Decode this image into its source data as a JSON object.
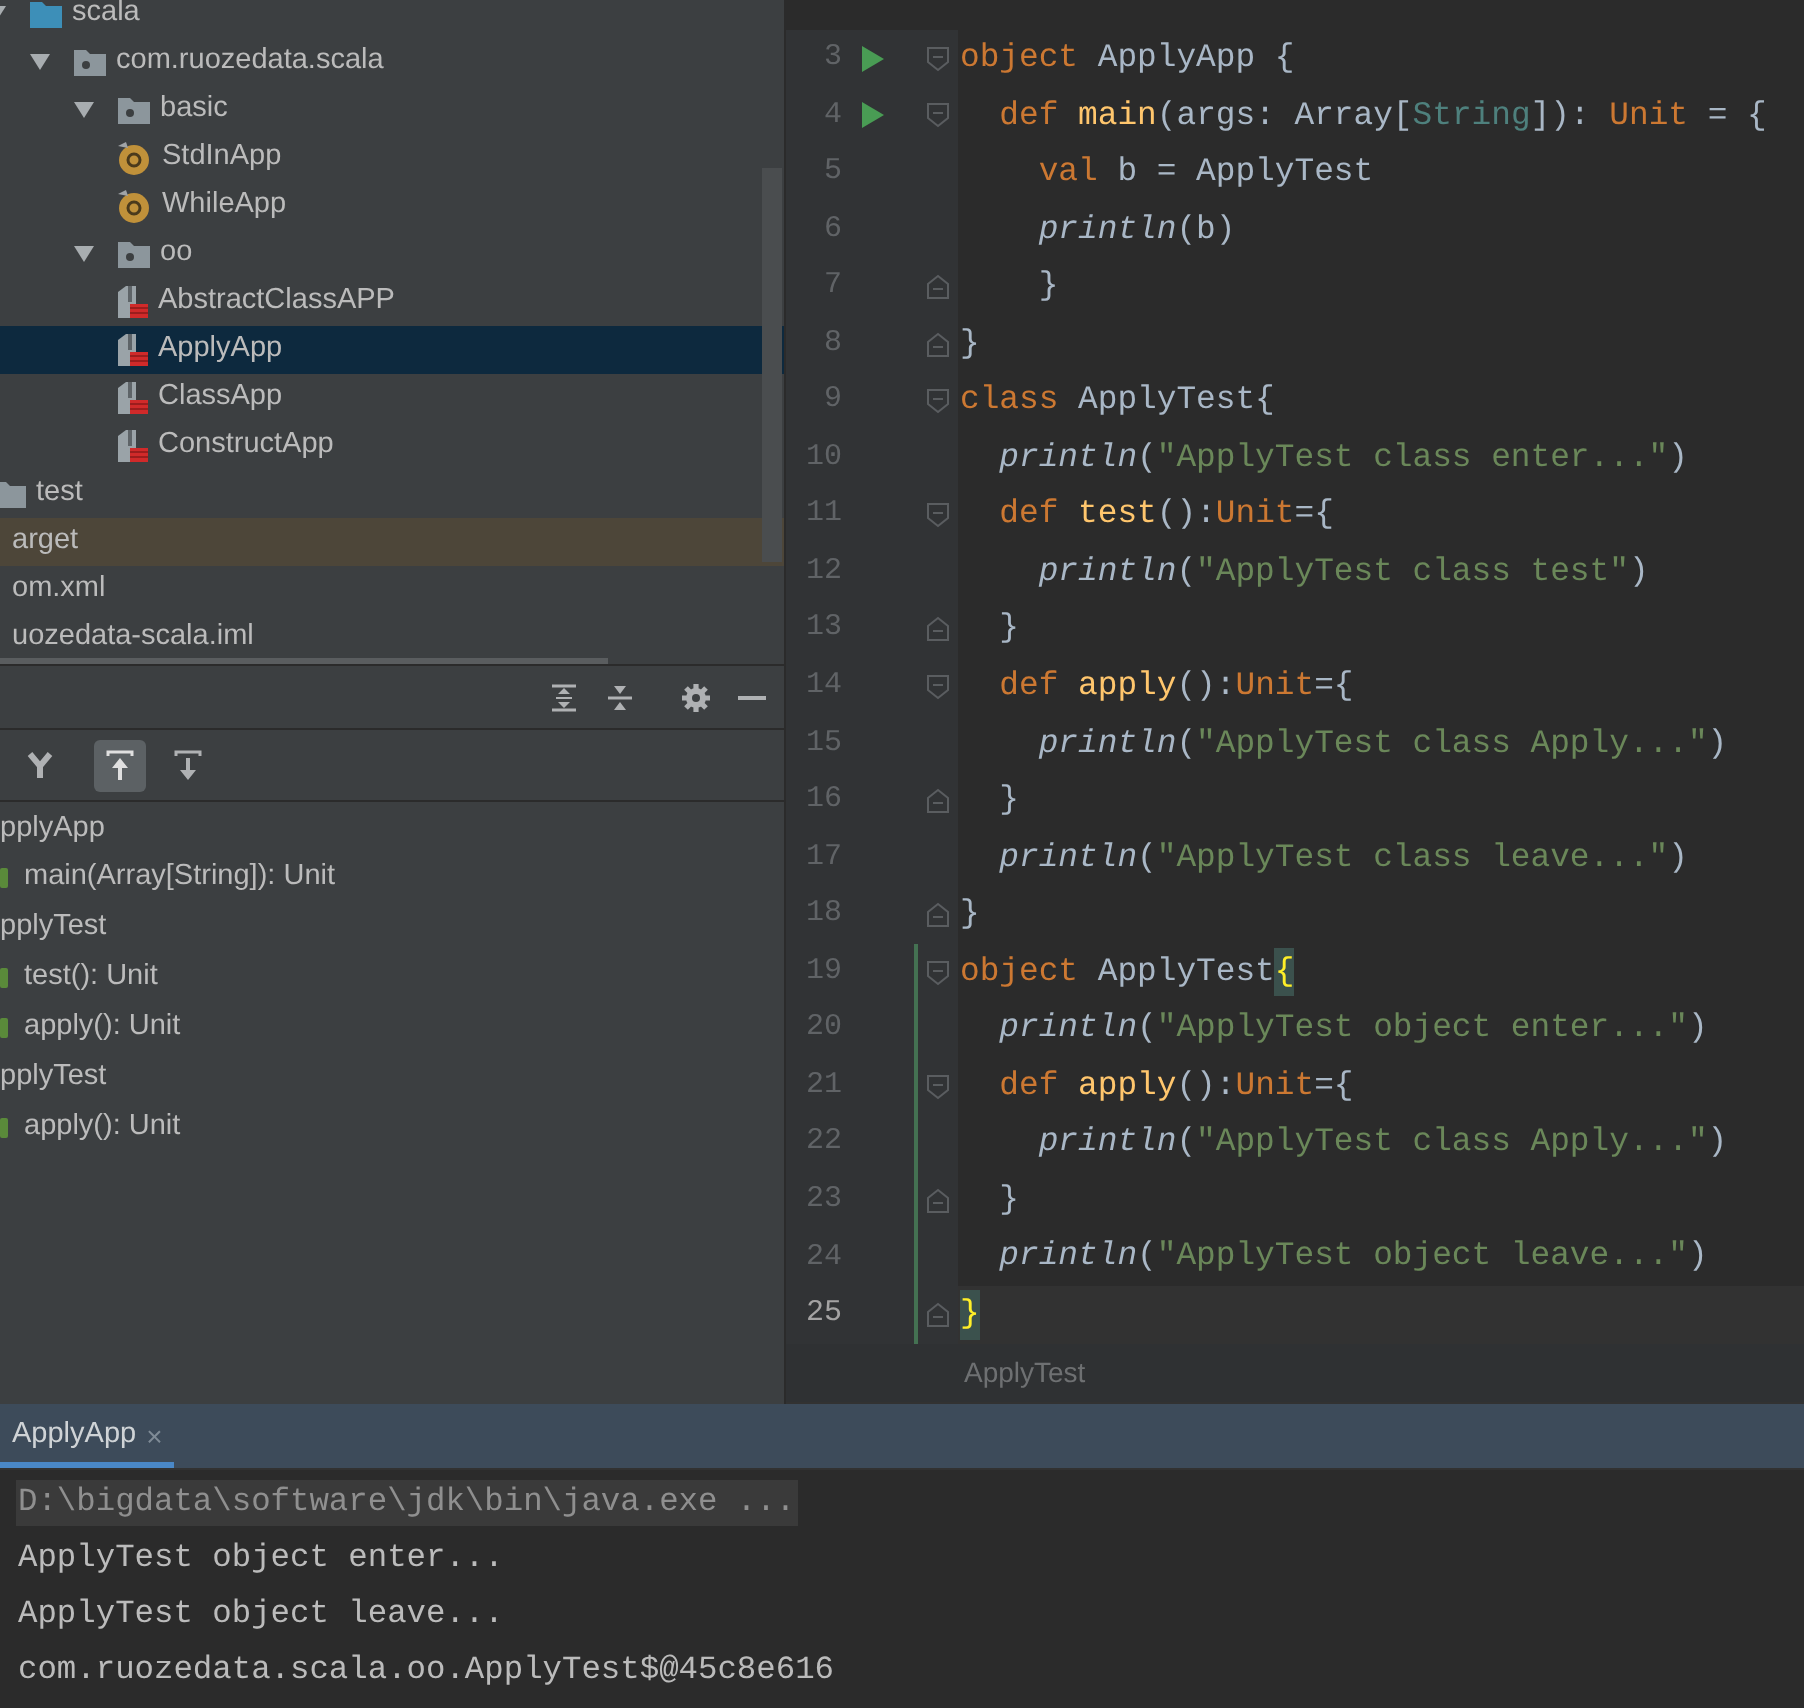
{
  "project_tree": [
    {
      "label": "scala",
      "kind": "source-folder",
      "expanded": true,
      "selected": false,
      "children": [
        {
          "label": "com.ruozedata.scala",
          "kind": "package",
          "expanded": true,
          "selected": false,
          "children": [
            {
              "label": "basic",
              "kind": "package",
              "expanded": true,
              "selected": false,
              "children": [
                {
                  "label": "StdInApp",
                  "kind": "object",
                  "selected": false
                },
                {
                  "label": "WhileApp",
                  "kind": "object",
                  "selected": false
                }
              ]
            },
            {
              "label": "oo",
              "kind": "package",
              "expanded": true,
              "selected": false,
              "children": [
                {
                  "label": "AbstractClassAPP",
                  "kind": "scala-file",
                  "selected": false
                },
                {
                  "label": "ApplyApp",
                  "kind": "scala-file",
                  "selected": true
                },
                {
                  "label": "ClassApp",
                  "kind": "scala-file",
                  "selected": false
                },
                {
                  "label": "ConstructApp",
                  "kind": "scala-file",
                  "selected": false
                }
              ]
            }
          ]
        }
      ]
    },
    {
      "label": "test",
      "kind": "folder",
      "selected": false
    },
    {
      "label": "arget",
      "kind": "excluded",
      "selected": false
    },
    {
      "label": "om.xml",
      "kind": "file",
      "selected": false
    },
    {
      "label": "uozedata-scala.iml",
      "kind": "file",
      "selected": false
    }
  ],
  "structure": {
    "header_tools": [
      {
        "kind": "expand-all"
      },
      {
        "kind": "collapse-all"
      },
      {
        "kind": "settings"
      },
      {
        "kind": "minimize"
      }
    ],
    "toolbar": [
      {
        "kind": "sort",
        "selected": false
      },
      {
        "kind": "show-inherited",
        "selected": true
      },
      {
        "kind": "show-members",
        "selected": false
      }
    ],
    "items": [
      {
        "label": "pplyApp",
        "children": [
          {
            "label": "main(Array[String]): Unit"
          }
        ]
      },
      {
        "label": "pplyTest",
        "children": [
          {
            "label": "test(): Unit"
          },
          {
            "label": "apply(): Unit"
          }
        ]
      },
      {
        "label": "pplyTest",
        "children": [
          {
            "label": "apply(): Unit"
          }
        ]
      }
    ]
  },
  "editor": {
    "lines": [
      {
        "number": "3",
        "run": true,
        "fold_start": true,
        "fold_end": false,
        "current": false,
        "changed": false,
        "tokens": [
          {
            "kind": "keyword",
            "text": "object "
          },
          {
            "kind": "plain",
            "text": "ApplyApp {"
          }
        ]
      },
      {
        "number": "4",
        "run": true,
        "fold_start": true,
        "fold_end": false,
        "current": false,
        "changed": false,
        "tokens": [
          {
            "kind": "keyword",
            "text": "  def "
          },
          {
            "kind": "method",
            "text": "main"
          },
          {
            "kind": "plain",
            "text": "(args: Array["
          },
          {
            "kind": "type",
            "text": "String"
          },
          {
            "kind": "plain",
            "text": "]): "
          },
          {
            "kind": "keyword",
            "text": "Unit"
          },
          {
            "kind": "plain",
            "text": " = {"
          }
        ]
      },
      {
        "number": "5",
        "run": false,
        "fold_start": false,
        "fold_end": false,
        "current": false,
        "changed": false,
        "tokens": [
          {
            "kind": "keyword",
            "text": "    val "
          },
          {
            "kind": "plain",
            "text": "b = ApplyTest"
          }
        ]
      },
      {
        "number": "6",
        "run": false,
        "fold_start": false,
        "fold_end": false,
        "current": false,
        "changed": false,
        "tokens": [
          {
            "kind": "call",
            "text": "    println"
          },
          {
            "kind": "plain",
            "text": "(b)"
          }
        ]
      },
      {
        "number": "7",
        "run": false,
        "fold_start": false,
        "fold_end": true,
        "current": false,
        "changed": false,
        "tokens": [
          {
            "kind": "plain",
            "text": "    }"
          }
        ]
      },
      {
        "number": "8",
        "run": false,
        "fold_start": false,
        "fold_end": true,
        "current": false,
        "changed": false,
        "tokens": [
          {
            "kind": "plain",
            "text": "}"
          }
        ]
      },
      {
        "number": "9",
        "run": false,
        "fold_start": true,
        "fold_end": false,
        "current": false,
        "changed": false,
        "tokens": [
          {
            "kind": "keyword",
            "text": "class "
          },
          {
            "kind": "plain",
            "text": "ApplyTest{"
          }
        ]
      },
      {
        "number": "10",
        "run": false,
        "fold_start": false,
        "fold_end": false,
        "current": false,
        "changed": false,
        "tokens": [
          {
            "kind": "call",
            "text": "  println"
          },
          {
            "kind": "plain",
            "text": "("
          },
          {
            "kind": "string",
            "text": "\"ApplyTest class enter...\""
          },
          {
            "kind": "plain",
            "text": ")"
          }
        ]
      },
      {
        "number": "11",
        "run": false,
        "fold_start": true,
        "fold_end": false,
        "current": false,
        "changed": false,
        "tokens": [
          {
            "kind": "keyword",
            "text": "  def "
          },
          {
            "kind": "method",
            "text": "test"
          },
          {
            "kind": "plain",
            "text": "():"
          },
          {
            "kind": "keyword",
            "text": "Unit"
          },
          {
            "kind": "plain",
            "text": "={"
          }
        ]
      },
      {
        "number": "12",
        "run": false,
        "fold_start": false,
        "fold_end": false,
        "current": false,
        "changed": false,
        "tokens": [
          {
            "kind": "call",
            "text": "    println"
          },
          {
            "kind": "plain",
            "text": "("
          },
          {
            "kind": "string",
            "text": "\"ApplyTest class test\""
          },
          {
            "kind": "plain",
            "text": ")"
          }
        ]
      },
      {
        "number": "13",
        "run": false,
        "fold_start": false,
        "fold_end": true,
        "current": false,
        "changed": false,
        "tokens": [
          {
            "kind": "plain",
            "text": "  }"
          }
        ]
      },
      {
        "number": "14",
        "run": false,
        "fold_start": true,
        "fold_end": false,
        "current": false,
        "changed": false,
        "tokens": [
          {
            "kind": "keyword",
            "text": "  def "
          },
          {
            "kind": "method",
            "text": "apply"
          },
          {
            "kind": "plain",
            "text": "():"
          },
          {
            "kind": "keyword",
            "text": "Unit"
          },
          {
            "kind": "plain",
            "text": "={"
          }
        ]
      },
      {
        "number": "15",
        "run": false,
        "fold_start": false,
        "fold_end": false,
        "current": false,
        "changed": false,
        "tokens": [
          {
            "kind": "call",
            "text": "    println"
          },
          {
            "kind": "plain",
            "text": "("
          },
          {
            "kind": "string",
            "text": "\"ApplyTest class Apply...\""
          },
          {
            "kind": "plain",
            "text": ")"
          }
        ]
      },
      {
        "number": "16",
        "run": false,
        "fold_start": false,
        "fold_end": true,
        "current": false,
        "changed": false,
        "tokens": [
          {
            "kind": "plain",
            "text": "  }"
          }
        ]
      },
      {
        "number": "17",
        "run": false,
        "fold_start": false,
        "fold_end": false,
        "current": false,
        "changed": false,
        "tokens": [
          {
            "kind": "call",
            "text": "  println"
          },
          {
            "kind": "plain",
            "text": "("
          },
          {
            "kind": "string",
            "text": "\"ApplyTest class leave...\""
          },
          {
            "kind": "plain",
            "text": ")"
          }
        ]
      },
      {
        "number": "18",
        "run": false,
        "fold_start": false,
        "fold_end": true,
        "current": false,
        "changed": false,
        "tokens": [
          {
            "kind": "plain",
            "text": "}"
          }
        ]
      },
      {
        "number": "19",
        "run": false,
        "fold_start": true,
        "fold_end": false,
        "current": false,
        "changed": true,
        "tokens": [
          {
            "kind": "keyword",
            "text": "object "
          },
          {
            "kind": "plain",
            "text": "ApplyTest"
          },
          {
            "kind": "brace-match",
            "text": "{"
          }
        ]
      },
      {
        "number": "20",
        "run": false,
        "fold_start": false,
        "fold_end": false,
        "current": false,
        "changed": true,
        "tokens": [
          {
            "kind": "call",
            "text": "  println"
          },
          {
            "kind": "plain",
            "text": "("
          },
          {
            "kind": "string",
            "text": "\"ApplyTest object enter...\""
          },
          {
            "kind": "plain",
            "text": ")"
          }
        ]
      },
      {
        "number": "21",
        "run": false,
        "fold_start": true,
        "fold_end": false,
        "current": false,
        "changed": true,
        "tokens": [
          {
            "kind": "keyword",
            "text": "  def "
          },
          {
            "kind": "method",
            "text": "apply"
          },
          {
            "kind": "plain",
            "text": "():"
          },
          {
            "kind": "keyword",
            "text": "Unit"
          },
          {
            "kind": "plain",
            "text": "={"
          }
        ]
      },
      {
        "number": "22",
        "run": false,
        "fold_start": false,
        "fold_end": false,
        "current": false,
        "changed": true,
        "tokens": [
          {
            "kind": "call",
            "text": "    println"
          },
          {
            "kind": "plain",
            "text": "("
          },
          {
            "kind": "string",
            "text": "\"ApplyTest class Apply...\""
          },
          {
            "kind": "plain",
            "text": ")"
          }
        ]
      },
      {
        "number": "23",
        "run": false,
        "fold_start": false,
        "fold_end": true,
        "current": false,
        "changed": true,
        "tokens": [
          {
            "kind": "plain",
            "text": "  }"
          }
        ]
      },
      {
        "number": "24",
        "run": false,
        "fold_start": false,
        "fold_end": false,
        "current": false,
        "changed": true,
        "tokens": [
          {
            "kind": "call",
            "text": "  println"
          },
          {
            "kind": "plain",
            "text": "("
          },
          {
            "kind": "string",
            "text": "\"ApplyTest object leave...\""
          },
          {
            "kind": "plain",
            "text": ")"
          }
        ]
      },
      {
        "number": "25",
        "run": false,
        "fold_start": false,
        "fold_end": true,
        "current": true,
        "changed": true,
        "tokens": [
          {
            "kind": "brace-match",
            "text": "}"
          }
        ]
      }
    ],
    "breadcrumb": "ApplyTest"
  },
  "run_panel": {
    "tabs": [
      {
        "label": "ApplyApp",
        "close": "×",
        "selected": true
      }
    ],
    "console": [
      {
        "kind": "command",
        "text": "D:\\bigdata\\software\\jdk\\bin\\java.exe ..."
      },
      {
        "kind": "output",
        "text": "ApplyTest object enter..."
      },
      {
        "kind": "output",
        "text": "ApplyTest object leave..."
      },
      {
        "kind": "output",
        "text": "com.ruozedata.scala.oo.ApplyTest$@45c8e616"
      }
    ]
  }
}
